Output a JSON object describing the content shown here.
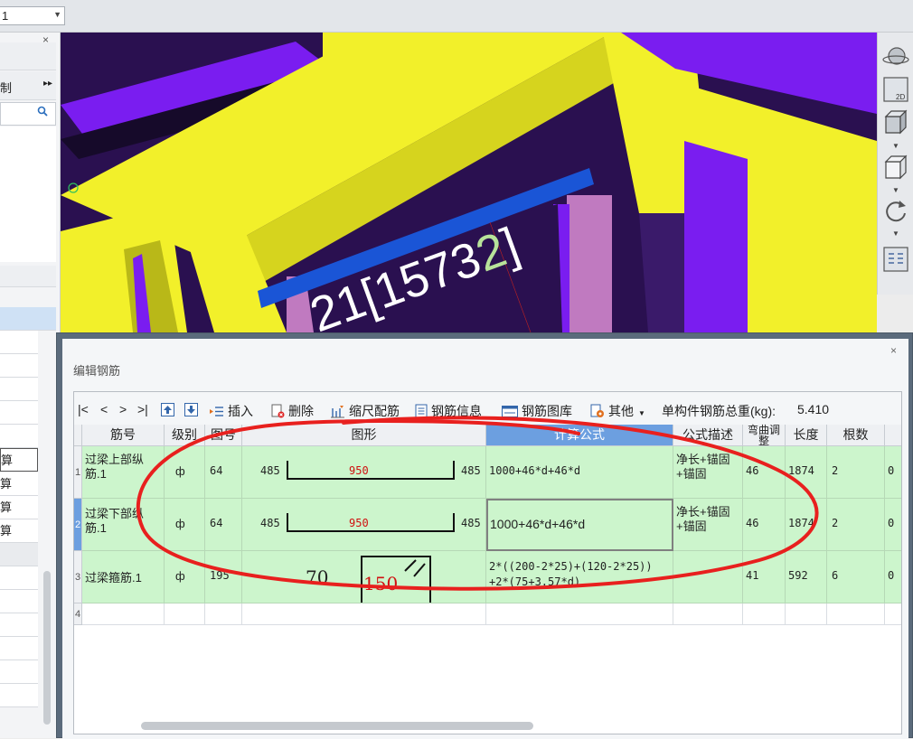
{
  "top_combo": {
    "value": "1"
  },
  "left_panel": {
    "close1": "×",
    "close2": "×",
    "item_label": "制",
    "item_more": "▸▸",
    "suan_items": [
      "算",
      "算",
      "算",
      "算"
    ]
  },
  "viewport": {
    "label_text": "[15732]",
    "label_digit_highlight": "2",
    "colors": {
      "purple": "#7a1df0",
      "dark_purple": "#2a1050",
      "yellow": "#f2f02a",
      "pink": "#c07ac0",
      "blue": "#1a55d6"
    }
  },
  "right_toolbar": [
    {
      "icon": "globe-icon"
    },
    {
      "icon": "view-2d-icon",
      "label": "2D"
    },
    {
      "icon": "cube-3d-icon"
    },
    {
      "icon": "cube-outline-icon"
    },
    {
      "icon": "rotate-icon"
    },
    {
      "icon": "layout-grid-icon"
    }
  ],
  "dialog": {
    "title": "编辑钢筋",
    "close": "×",
    "toolbar": {
      "nav": [
        "|<",
        "<",
        ">",
        ">|"
      ],
      "insert": "插入",
      "delete": "删除",
      "scale": "缩尺配筋",
      "info": "钢筋信息",
      "library": "钢筋图库",
      "other": "其他",
      "total_label": "单构件钢筋总重(kg):",
      "total_value": "5.410"
    },
    "columns": [
      "筋号",
      "级别",
      "图号",
      "图形",
      "计算公式",
      "公式描述",
      "弯曲调整",
      "长度",
      "根数",
      ""
    ],
    "rows": [
      {
        "num": "1",
        "name": "过梁上部纵筋.1",
        "grade": "ф",
        "fig": "64",
        "shape_left": "485",
        "shape_mid": "950",
        "shape_right": "485",
        "formula": "1000+46*d+46*d",
        "desc": "净长+锚固+锚固",
        "bend": "46",
        "length": "1874",
        "count": "2",
        "extra": "0"
      },
      {
        "num": "2",
        "name": "过梁下部纵筋.1",
        "grade": "ф",
        "fig": "64",
        "shape_left": "485",
        "shape_mid": "950",
        "shape_right": "485",
        "formula": "1000+46*d+46*d",
        "desc": "净长+锚固+锚固",
        "bend": "46",
        "length": "1874",
        "count": "2",
        "extra": "0"
      },
      {
        "num": "3",
        "name": "过梁箍筋.1",
        "grade": "ф",
        "fig": "195",
        "shape_left": "70",
        "shape_mid": "150",
        "shape_right": "",
        "formula_line1": "2*((200-2*25)+(120-2*25))",
        "formula_line2": "+2*(75+3.57*d)",
        "desc": "",
        "bend": "41",
        "length": "592",
        "count": "6",
        "extra": "0"
      },
      {
        "num": "4"
      }
    ]
  }
}
